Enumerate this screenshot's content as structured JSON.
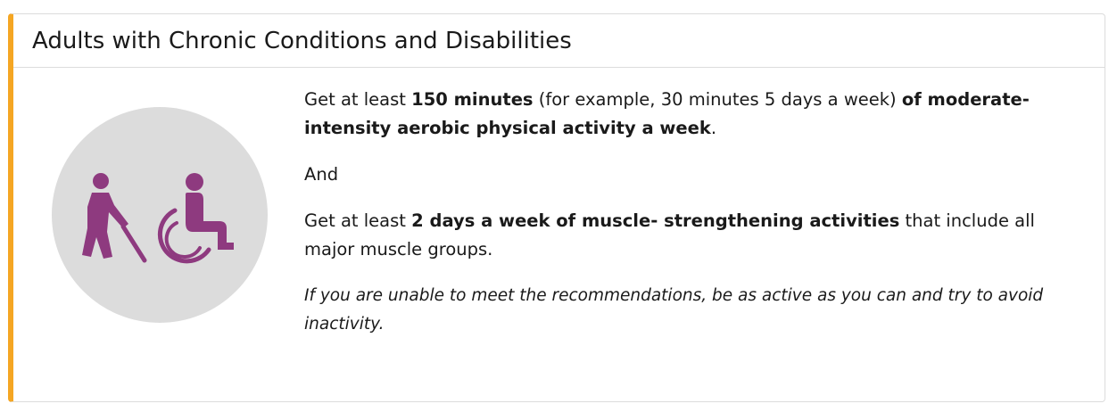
{
  "card": {
    "title": "Adults with Chronic Conditions and Disabilities",
    "accent_color": "#f5a623",
    "icon": {
      "name": "person-with-cane-and-wheelchair-icon",
      "circle_color": "#dcdcdc",
      "figure_color": "#8e3a7f"
    },
    "paragraph1": {
      "t1": "Get at least ",
      "b1": "150 minutes",
      "t2": " (for example, 30 minutes 5 days a week) ",
      "b2": "of moderate-intensity aerobic physical activity a week",
      "t3": "."
    },
    "paragraph2": "And",
    "paragraph3": {
      "t1": "Get at least ",
      "b1": "2 days a week of muscle- strengthening activities",
      "t2": " that include all major muscle groups."
    },
    "note": "If you are unable to meet the recommendations, be as active as you can and try to avoid inactivity."
  }
}
